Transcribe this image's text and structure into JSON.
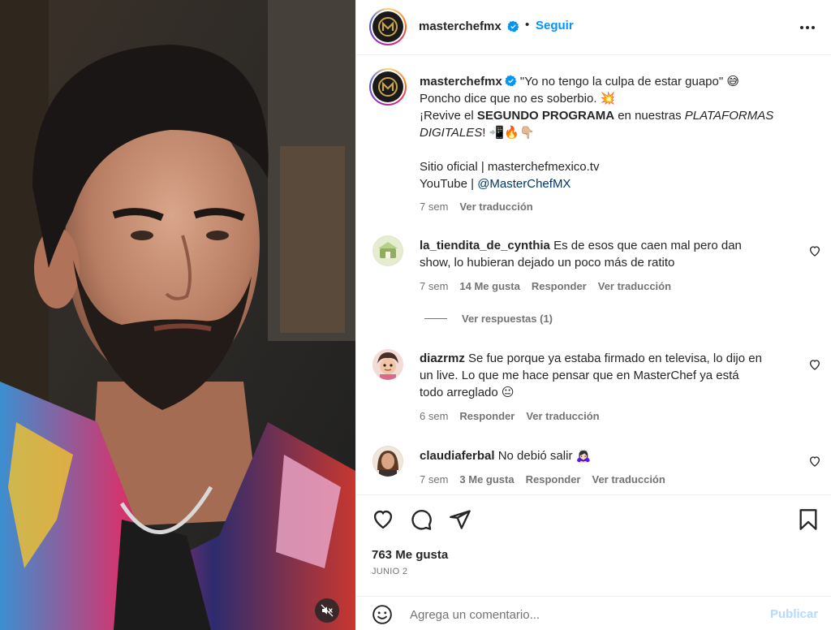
{
  "header": {
    "username": "masterchefmx",
    "separator": "•",
    "follow_label": "Seguir",
    "more_icon": "more-horizontal-icon"
  },
  "caption": {
    "username": "masterchefmx",
    "line1": "\"Yo no tengo la culpa de estar guapo\"",
    "line1_emoji": "😅",
    "line2": "Poncho dice que no es soberbio.",
    "line2_emoji": "💥",
    "line3_pre": "¡Revive el ",
    "line3_bold": "SEGUNDO PROGRAMA",
    "line3_mid": " en nuestras ",
    "line3_italic_a": "PLATAFORMAS",
    "line4_italic_b": "DIGITALES",
    "line4_post": "!",
    "line4_emojis": "📲🔥👇🏼",
    "site_line": "Sitio oficial | masterchefmexico.tv",
    "youtube_pre": "YouTube | ",
    "youtube_handle": "@MasterChefMX",
    "time": "7 sem",
    "translate": "Ver traducción"
  },
  "comments": [
    {
      "username": "la_tiendita_de_cynthia",
      "text_line1": "Es de esos que caen mal pero dan",
      "text_line2": "show, lo hubieran dejado un poco más de ratito",
      "time": "7 sem",
      "likes": "14 Me gusta",
      "reply": "Responder",
      "translate": "Ver traducción",
      "view_replies": "Ver respuestas (1)"
    },
    {
      "username": "diazrmz",
      "text_line1": "Se fue porque ya estaba firmado en televisa, lo dijo en",
      "text_line2": "un live. Lo que me hace pensar que en MasterChef ya está",
      "text_line3": "todo arreglado",
      "emoji": "😐",
      "time": "6 sem",
      "reply": "Responder",
      "translate": "Ver traducción"
    },
    {
      "username": "claudiaferbal",
      "text_line1": "No debió salir",
      "emoji": "🙇🏻‍♀️",
      "time": "7 sem",
      "likes": "3 Me gusta",
      "reply": "Responder",
      "translate": "Ver traducción"
    }
  ],
  "actions": {
    "like_icon": "heart-icon",
    "comment_icon": "comment-icon",
    "share_icon": "send-icon",
    "save_icon": "bookmark-icon",
    "likes_count": "763 Me gusta",
    "date": "JUNIO 2"
  },
  "composer": {
    "emoji_icon": "emoji-icon",
    "placeholder": "Agrega un comentario...",
    "publish_label": "Publicar"
  },
  "media": {
    "mute_icon": "muted-speaker-icon"
  },
  "colors": {
    "link_blue": "#0095f6",
    "publish_disabled": "#b3dbff",
    "muted_text": "#737373",
    "text": "#262626",
    "handle_link": "#00376b"
  }
}
